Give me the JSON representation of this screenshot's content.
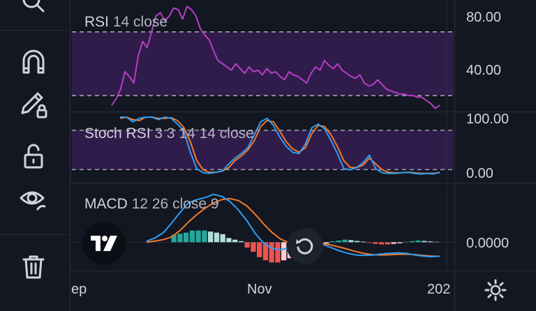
{
  "colors": {
    "background": "#131722",
    "rsi_line": "#b63fc4",
    "band_fill": "#3b1f5a",
    "stoch_k": "#2f9ff0",
    "stoch_d": "#f17a2a",
    "macd_line": "#2f9ff0",
    "signal_line": "#f17a2a",
    "hist_up_strong": "#b2dfdb",
    "hist_up_weak": "#26a69a",
    "hist_down_strong": "#ef5350",
    "hist_down_weak": "#ffcdd2"
  },
  "toolbar": {
    "icons": [
      "zoom-icon",
      "magnet-icon",
      "pencil-lock-icon",
      "unlock-icon",
      "eye-icon",
      "trash-icon"
    ]
  },
  "panes": {
    "rsi": {
      "name": "RSI",
      "params": "14 close"
    },
    "stoch": {
      "name": "Stoch RSI",
      "params": "3 3 14 14 close"
    },
    "macd": {
      "name": "MACD",
      "params": "12 26 close 9"
    }
  },
  "price_scale": {
    "rsi_top": "80.00",
    "rsi_bottom": "40.00",
    "stoch_top": "100.00",
    "stoch_bottom": "0.00",
    "macd_zero": "0.0000"
  },
  "time_scale": {
    "left": "ep",
    "mid": "Nov",
    "right": "202"
  },
  "chart_data": [
    {
      "type": "line",
      "title": "RSI 14 close",
      "ylim": [
        20,
        90
      ],
      "bands": [
        30,
        70
      ],
      "series": [
        {
          "name": "RSI",
          "values": [
            24,
            28,
            34,
            45,
            42,
            38,
            55,
            64,
            60,
            70,
            80,
            82,
            77,
            80,
            85,
            84,
            78,
            86,
            84,
            80,
            72,
            68,
            65,
            58,
            52,
            50,
            48,
            46,
            50,
            47,
            44,
            48,
            45,
            46,
            43,
            47,
            44,
            45,
            42,
            40,
            45,
            43,
            42,
            40,
            38,
            44,
            48,
            46,
            52,
            49,
            47,
            50,
            46,
            44,
            42,
            41,
            43,
            38,
            36,
            37,
            40,
            37,
            34,
            33,
            32,
            31,
            31,
            30,
            30,
            29,
            29,
            27,
            25,
            22,
            24
          ]
        }
      ]
    },
    {
      "type": "line",
      "title": "Stoch RSI 3 3 14 14 close",
      "ylim": [
        0,
        100
      ],
      "bands": [
        20,
        80
      ],
      "series": [
        {
          "name": "K",
          "values": [
            100,
            100,
            92,
            98,
            100,
            100,
            96,
            100,
            98,
            88,
            76,
            40,
            12,
            5,
            4,
            6,
            8,
            20,
            30,
            38,
            48,
            70,
            92,
            98,
            86,
            66,
            50,
            40,
            38,
            54,
            82,
            88,
            80,
            60,
            38,
            12,
            10,
            14,
            22,
            35,
            12,
            5,
            4,
            4,
            5,
            6,
            4,
            3,
            4,
            3,
            6
          ]
        },
        {
          "name": "D",
          "values": [
            98,
            100,
            96,
            94,
            100,
            100,
            98,
            98,
            99,
            94,
            82,
            58,
            26,
            10,
            6,
            6,
            8,
            14,
            26,
            34,
            44,
            60,
            84,
            94,
            92,
            76,
            58,
            46,
            40,
            48,
            72,
            86,
            84,
            70,
            50,
            26,
            14,
            14,
            18,
            30,
            20,
            10,
            6,
            5,
            5,
            6,
            5,
            4,
            4,
            4,
            5
          ]
        }
      ]
    },
    {
      "type": "line",
      "title": "MACD 12 26 close 9",
      "ylim": [
        -1.2,
        2.6
      ],
      "series": [
        {
          "name": "MACD",
          "values": [
            0.05,
            0.2,
            0.45,
            0.9,
            1.4,
            1.85,
            2.0,
            2.1,
            2.25,
            2.15,
            1.9,
            1.5,
            1.0,
            0.4,
            -0.05,
            -0.3,
            -0.35,
            -0.28,
            -0.2,
            -0.12,
            -0.05,
            -0.1,
            -0.25,
            -0.4,
            -0.52,
            -0.6,
            -0.62,
            -0.6,
            -0.55,
            -0.52,
            -0.5,
            -0.52,
            -0.6,
            -0.65,
            -0.68,
            -0.66
          ]
        },
        {
          "name": "Signal",
          "values": [
            0.0,
            0.05,
            0.12,
            0.25,
            0.55,
            0.95,
            1.3,
            1.6,
            1.85,
            2.0,
            2.05,
            1.95,
            1.7,
            1.3,
            0.85,
            0.45,
            0.15,
            -0.02,
            -0.08,
            -0.08,
            -0.05,
            -0.07,
            -0.13,
            -0.22,
            -0.33,
            -0.44,
            -0.53,
            -0.58,
            -0.6,
            -0.59,
            -0.57,
            -0.56,
            -0.58,
            -0.62,
            -0.65,
            -0.66
          ]
        }
      ],
      "histogram": [
        0.0,
        0.0,
        0.0,
        0.0,
        0.35,
        0.4,
        0.45,
        0.55,
        0.55,
        0.55,
        0.5,
        0.45,
        0.38,
        0.2,
        0.12,
        0.05,
        -0.25,
        -0.45,
        -0.7,
        -0.85,
        -0.95,
        -0.95,
        -0.85,
        -0.75,
        -0.6,
        -0.45,
        -0.35,
        -0.22,
        -0.12,
        -0.06,
        0.04,
        0.08,
        0.12,
        0.1,
        0.06,
        0.03,
        -0.03,
        -0.08,
        -0.1,
        -0.1,
        -0.08,
        -0.05,
        0.02,
        0.05,
        0.08,
        0.06,
        0.04,
        0.02
      ]
    }
  ]
}
